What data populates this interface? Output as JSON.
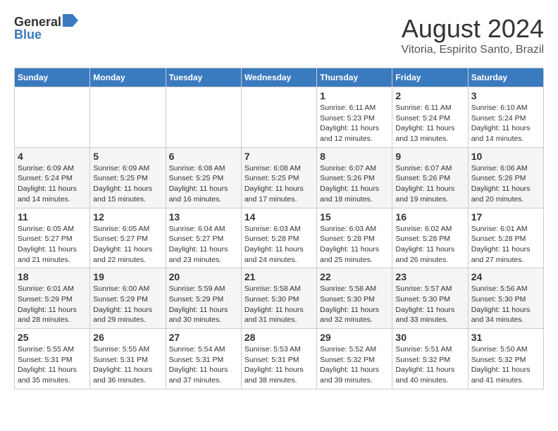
{
  "header": {
    "logo_general": "General",
    "logo_blue": "Blue",
    "month_title": "August 2024",
    "location": "Vitoria, Espirito Santo, Brazil"
  },
  "weekdays": [
    "Sunday",
    "Monday",
    "Tuesday",
    "Wednesday",
    "Thursday",
    "Friday",
    "Saturday"
  ],
  "weeks": [
    [
      {
        "day": "",
        "info": ""
      },
      {
        "day": "",
        "info": ""
      },
      {
        "day": "",
        "info": ""
      },
      {
        "day": "",
        "info": ""
      },
      {
        "day": "1",
        "info": "Sunrise: 6:11 AM\nSunset: 5:23 PM\nDaylight: 11 hours\nand 12 minutes."
      },
      {
        "day": "2",
        "info": "Sunrise: 6:11 AM\nSunset: 5:24 PM\nDaylight: 11 hours\nand 13 minutes."
      },
      {
        "day": "3",
        "info": "Sunrise: 6:10 AM\nSunset: 5:24 PM\nDaylight: 11 hours\nand 14 minutes."
      }
    ],
    [
      {
        "day": "4",
        "info": "Sunrise: 6:09 AM\nSunset: 5:24 PM\nDaylight: 11 hours\nand 14 minutes."
      },
      {
        "day": "5",
        "info": "Sunrise: 6:09 AM\nSunset: 5:25 PM\nDaylight: 11 hours\nand 15 minutes."
      },
      {
        "day": "6",
        "info": "Sunrise: 6:08 AM\nSunset: 5:25 PM\nDaylight: 11 hours\nand 16 minutes."
      },
      {
        "day": "7",
        "info": "Sunrise: 6:08 AM\nSunset: 5:25 PM\nDaylight: 11 hours\nand 17 minutes."
      },
      {
        "day": "8",
        "info": "Sunrise: 6:07 AM\nSunset: 5:26 PM\nDaylight: 11 hours\nand 18 minutes."
      },
      {
        "day": "9",
        "info": "Sunrise: 6:07 AM\nSunset: 5:26 PM\nDaylight: 11 hours\nand 19 minutes."
      },
      {
        "day": "10",
        "info": "Sunrise: 6:06 AM\nSunset: 5:26 PM\nDaylight: 11 hours\nand 20 minutes."
      }
    ],
    [
      {
        "day": "11",
        "info": "Sunrise: 6:05 AM\nSunset: 5:27 PM\nDaylight: 11 hours\nand 21 minutes."
      },
      {
        "day": "12",
        "info": "Sunrise: 6:05 AM\nSunset: 5:27 PM\nDaylight: 11 hours\nand 22 minutes."
      },
      {
        "day": "13",
        "info": "Sunrise: 6:04 AM\nSunset: 5:27 PM\nDaylight: 11 hours\nand 23 minutes."
      },
      {
        "day": "14",
        "info": "Sunrise: 6:03 AM\nSunset: 5:28 PM\nDaylight: 11 hours\nand 24 minutes."
      },
      {
        "day": "15",
        "info": "Sunrise: 6:03 AM\nSunset: 5:28 PM\nDaylight: 11 hours\nand 25 minutes."
      },
      {
        "day": "16",
        "info": "Sunrise: 6:02 AM\nSunset: 5:28 PM\nDaylight: 11 hours\nand 26 minutes."
      },
      {
        "day": "17",
        "info": "Sunrise: 6:01 AM\nSunset: 5:28 PM\nDaylight: 11 hours\nand 27 minutes."
      }
    ],
    [
      {
        "day": "18",
        "info": "Sunrise: 6:01 AM\nSunset: 5:29 PM\nDaylight: 11 hours\nand 28 minutes."
      },
      {
        "day": "19",
        "info": "Sunrise: 6:00 AM\nSunset: 5:29 PM\nDaylight: 11 hours\nand 29 minutes."
      },
      {
        "day": "20",
        "info": "Sunrise: 5:59 AM\nSunset: 5:29 PM\nDaylight: 11 hours\nand 30 minutes."
      },
      {
        "day": "21",
        "info": "Sunrise: 5:58 AM\nSunset: 5:30 PM\nDaylight: 11 hours\nand 31 minutes."
      },
      {
        "day": "22",
        "info": "Sunrise: 5:58 AM\nSunset: 5:30 PM\nDaylight: 11 hours\nand 32 minutes."
      },
      {
        "day": "23",
        "info": "Sunrise: 5:57 AM\nSunset: 5:30 PM\nDaylight: 11 hours\nand 33 minutes."
      },
      {
        "day": "24",
        "info": "Sunrise: 5:56 AM\nSunset: 5:30 PM\nDaylight: 11 hours\nand 34 minutes."
      }
    ],
    [
      {
        "day": "25",
        "info": "Sunrise: 5:55 AM\nSunset: 5:31 PM\nDaylight: 11 hours\nand 35 minutes."
      },
      {
        "day": "26",
        "info": "Sunrise: 5:55 AM\nSunset: 5:31 PM\nDaylight: 11 hours\nand 36 minutes."
      },
      {
        "day": "27",
        "info": "Sunrise: 5:54 AM\nSunset: 5:31 PM\nDaylight: 11 hours\nand 37 minutes."
      },
      {
        "day": "28",
        "info": "Sunrise: 5:53 AM\nSunset: 5:31 PM\nDaylight: 11 hours\nand 38 minutes."
      },
      {
        "day": "29",
        "info": "Sunrise: 5:52 AM\nSunset: 5:32 PM\nDaylight: 11 hours\nand 39 minutes."
      },
      {
        "day": "30",
        "info": "Sunrise: 5:51 AM\nSunset: 5:32 PM\nDaylight: 11 hours\nand 40 minutes."
      },
      {
        "day": "31",
        "info": "Sunrise: 5:50 AM\nSunset: 5:32 PM\nDaylight: 11 hours\nand 41 minutes."
      }
    ]
  ]
}
